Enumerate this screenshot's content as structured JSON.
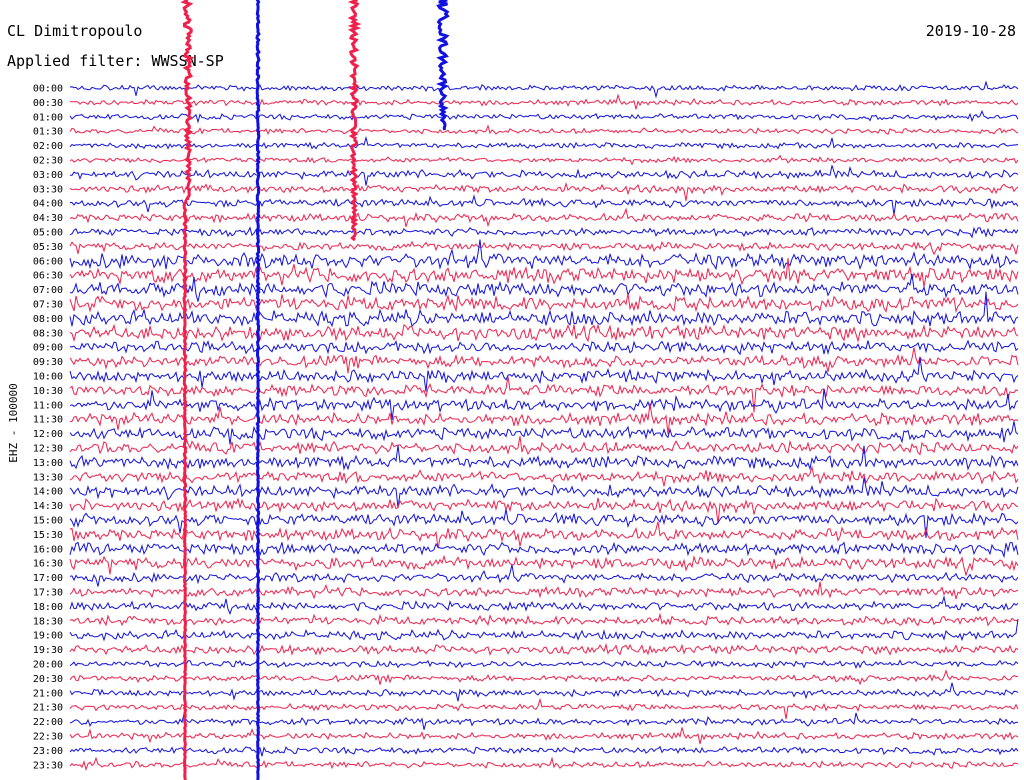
{
  "header": {
    "station": "CL Dimitropoulo",
    "filter": "Applied filter: WWSSN-SP",
    "date": "2019-10-28"
  },
  "chart_data": {
    "type": "line",
    "title": "CL Dimitropoulo",
    "ylabel": "EHZ - 100000",
    "time_labels": [
      "00:00",
      "00:30",
      "01:00",
      "01:30",
      "02:00",
      "02:30",
      "03:00",
      "03:30",
      "04:00",
      "04:30",
      "05:00",
      "05:30",
      "06:00",
      "06:30",
      "07:00",
      "07:30",
      "08:00",
      "08:30",
      "09:00",
      "09:30",
      "10:00",
      "10:30",
      "11:00",
      "11:30",
      "12:00",
      "12:30",
      "13:00",
      "13:30",
      "14:00",
      "14:30",
      "15:00",
      "15:30",
      "16:00",
      "16:30",
      "17:00",
      "17:30",
      "18:00",
      "18:30",
      "19:00",
      "19:30",
      "20:00",
      "20:30",
      "21:00",
      "21:30",
      "22:00",
      "22:30",
      "23:00",
      "23:30"
    ],
    "trace_colors": [
      "#1010e0",
      "#f0204a"
    ],
    "grid": false
  }
}
